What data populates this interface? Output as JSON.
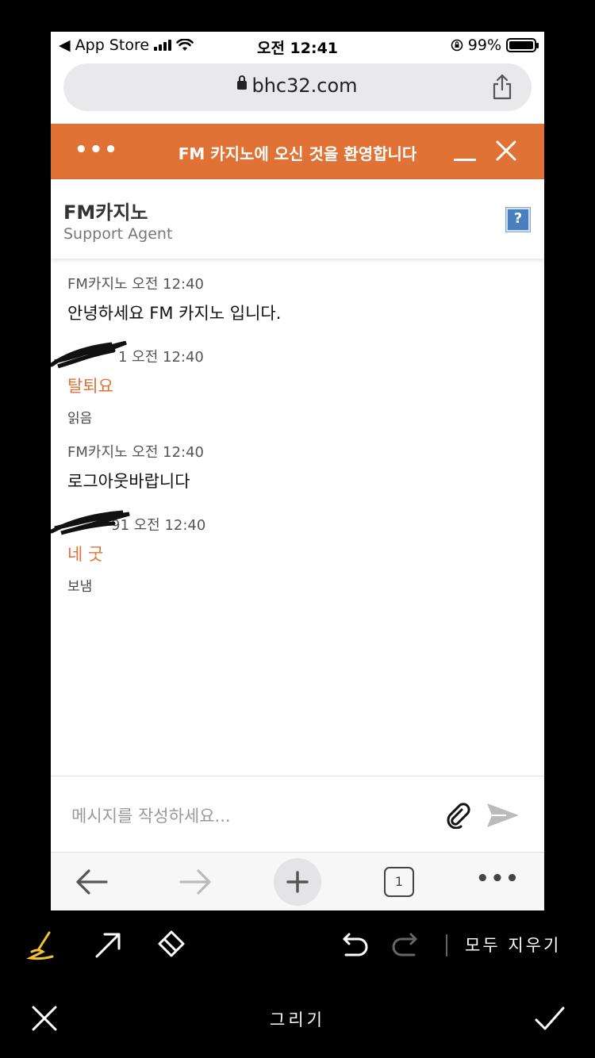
{
  "status_bar": {
    "back_label": "◀ App Store",
    "time": "오전 12:41",
    "battery": "99%"
  },
  "browser": {
    "url": "bhc32.com",
    "tab_count": "1"
  },
  "chat": {
    "header_title": "FM 카지노에 오신 것을 환영합니다",
    "agent_name": "FM카지노",
    "agent_role": "Support Agent",
    "help_label": "?",
    "messages": [
      {
        "meta": "FM카지노 오전 12:40",
        "text": "안녕하세요 FM 카지노 입니다.",
        "state": ""
      },
      {
        "meta": "1 오전 12:40",
        "text": "탈퇴요",
        "state": "읽음"
      },
      {
        "meta": "FM카지노 오전 12:40",
        "text": "로그아웃바랍니다",
        "state": ""
      },
      {
        "meta": "91 오전 12:40",
        "text": "네 굿",
        "state": "보냄"
      }
    ],
    "composer_placeholder": "메시지를 작성하세요..."
  },
  "drawing_bar": {
    "clear_all": "모두 지우기",
    "title": "그리기"
  },
  "colors": {
    "brand": "#e07236",
    "highlight_tool": "#f2c230"
  }
}
